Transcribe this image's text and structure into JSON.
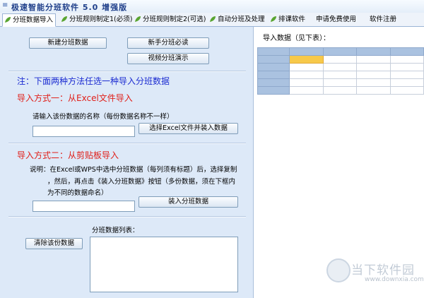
{
  "window": {
    "title": "极速智能分班软件 5.0 增强版"
  },
  "tabs": [
    {
      "label": "分班数据导入",
      "active": true,
      "icon": "leaf-icon"
    },
    {
      "label": "分班规则制定1(必须)",
      "active": false,
      "icon": "leaf-icon"
    },
    {
      "label": "分班规则制定2(可选)",
      "active": false,
      "icon": "leaf-icon"
    },
    {
      "label": "自动分班及处理",
      "active": false,
      "icon": "leaf-icon"
    },
    {
      "label": "排课软件",
      "active": false,
      "icon": "leaf-icon"
    },
    {
      "label": "申请免费使用",
      "active": false,
      "icon": ""
    },
    {
      "label": "软件注册",
      "active": false,
      "icon": ""
    }
  ],
  "left": {
    "buttons": {
      "new_data": "新建分班数据",
      "novice": "新手分班必读",
      "video": "视频分班演示",
      "select_excel": "选择Excel文件并装入数据",
      "load_data": "装入分班数据",
      "clear_data": "清除该份数据"
    },
    "note": "注：下面两种方法任选一种导入分班数据",
    "method1": {
      "title": "导入方式一：从Excel文件导入",
      "prompt": "请输入该份数据的名称（每份数据名称不一样）",
      "name_value": ""
    },
    "method2": {
      "title": "导入方式二：从剪贴板导入",
      "desc_line1": "说明：在Excel或WPS中选中分班数据（每列须有标题）后，选择复制",
      "desc_line2": "，然后，再点击《装入分班数据》按钮（多份数据，须在下框内",
      "desc_line3": "为不同的数据命名）",
      "name_value": ""
    },
    "list": {
      "label": "分班数据列表：",
      "items": []
    }
  },
  "right": {
    "label": "导入数据（见下表）：",
    "grid": {
      "rows": 6,
      "cols": 5,
      "selected": [
        1,
        1
      ]
    }
  },
  "watermark": {
    "text": "当下软件园",
    "url": "www.downxia.com"
  },
  "colors": {
    "panel": "#dde9f8",
    "note": "#1b2bd1",
    "heading": "#e0201a",
    "selection": "#f7c94a"
  }
}
